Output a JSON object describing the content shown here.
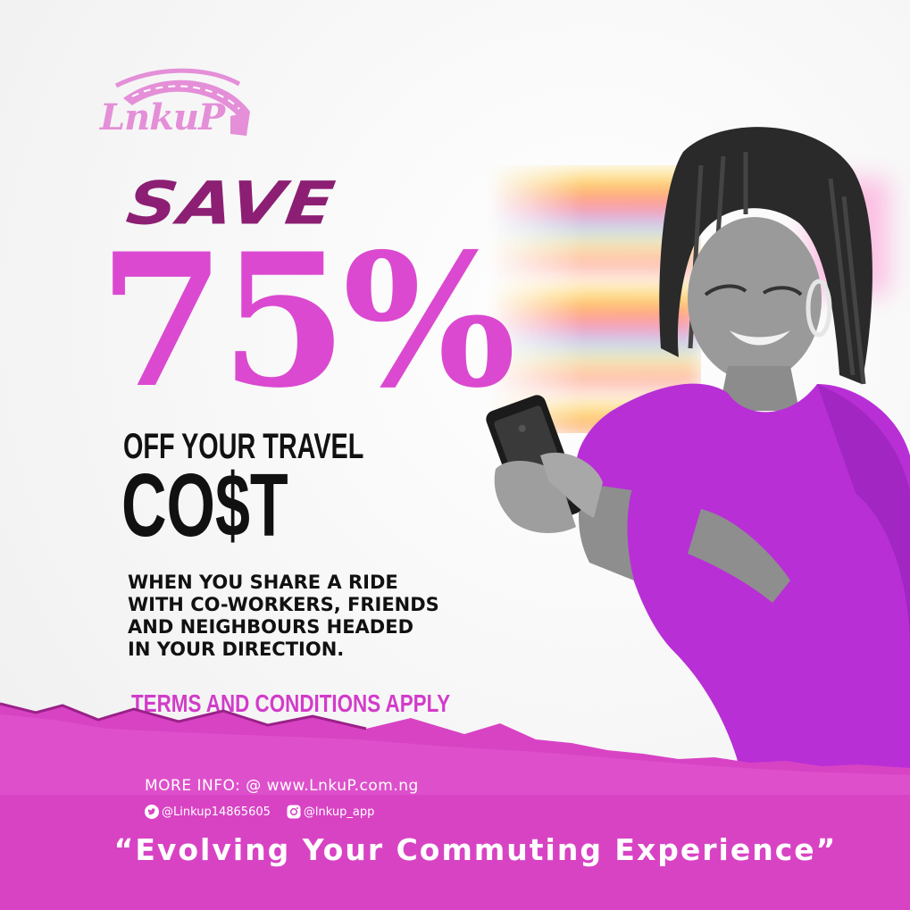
{
  "brand": {
    "logo_text": "LnkuP"
  },
  "headline": {
    "save": "SAVE",
    "percent": "75%",
    "off_line": "OFF YOUR TRAVEL",
    "cost_line": "CO$T"
  },
  "body": {
    "lines": [
      "WHEN YOU SHARE A RIDE",
      "WITH CO-WORKERS, FRIENDS",
      "AND NEIGHBOURS HEADED",
      "IN YOUR DIRECTION."
    ]
  },
  "terms": "TERMS AND CONDITIONS APPLY",
  "footer": {
    "more_info": "MORE INFO: @ www.LnkuP.com.ng",
    "twitter": "@Linkup14865605",
    "instagram": "@lnkup_app",
    "tagline": "“Evolving Your Commuting Experience”"
  },
  "icons": {
    "twitter": "twitter-icon",
    "instagram": "instagram-icon"
  },
  "colors": {
    "brand_magenta": "#db49d0",
    "brand_plum": "#8c1f73",
    "footer_pink": "#d843c4",
    "logo_pink": "#e48fd8",
    "dress_purple": "#b82fd6",
    "text_dark": "#111111"
  }
}
